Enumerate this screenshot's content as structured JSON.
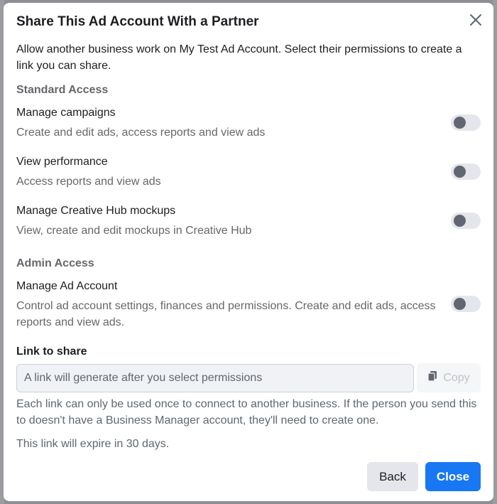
{
  "dialog": {
    "title": "Share This Ad Account With a Partner",
    "close_icon": "close-icon",
    "intro": "Allow another business work on My Test Ad Account. Select their permissions to create a link you can share."
  },
  "standard_access": {
    "heading": "Standard Access",
    "permissions": [
      {
        "title": "Manage campaigns",
        "description": "Create and edit ads, access reports and view ads",
        "enabled": false
      },
      {
        "title": "View performance",
        "description": "Access reports and view ads",
        "enabled": false
      },
      {
        "title": "Manage Creative Hub mockups",
        "description": "View, create and edit mockups in Creative Hub",
        "enabled": false
      }
    ]
  },
  "admin_access": {
    "heading": "Admin Access",
    "permissions": [
      {
        "title": "Manage Ad Account",
        "description": "Control ad account settings, finances and permissions. Create and edit ads, access reports and view ads.",
        "enabled": false
      }
    ]
  },
  "link": {
    "label": "Link to share",
    "placeholder": "A link will generate after you select permissions",
    "copy_label": "Copy",
    "copy_icon": "copy-icon",
    "note": "Each link can only be used once to connect to another business. If the person you send this to doesn't have a Business Manager account, they'll need to create one.",
    "expiry": "This link will expire in 30 days."
  },
  "footer": {
    "back_label": "Back",
    "close_label": "Close"
  },
  "colors": {
    "primary": "#1877f2",
    "toggle_off_track": "#e4e6eb",
    "toggle_off_knob": "#606770"
  }
}
